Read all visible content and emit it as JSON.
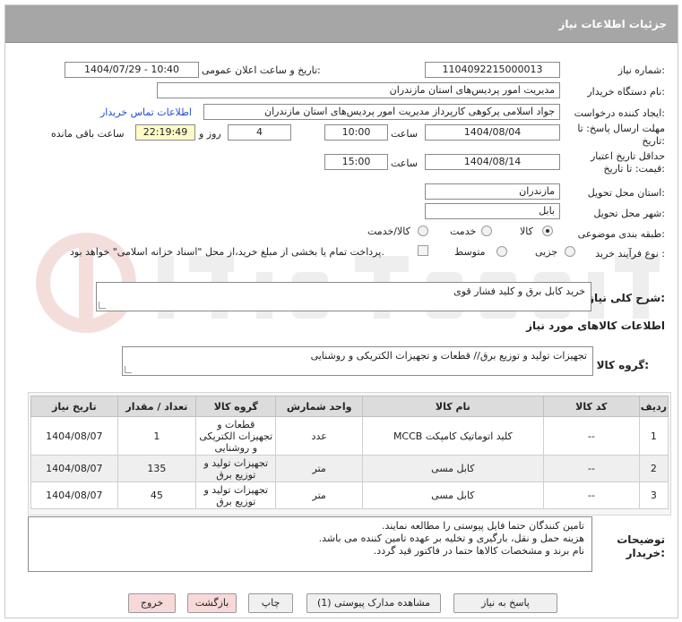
{
  "header": {
    "title": "جزئیات اطلاعات نیاز"
  },
  "form": {
    "need_number": {
      "label": "شماره نیاز:",
      "value": "1104092215000013"
    },
    "announce": {
      "label": "تاریخ و ساعت اعلان عمومی:",
      "value": "1404/07/29 - 10:40"
    },
    "buyer_org": {
      "label": "نام دستگاه خریدار:",
      "value": "مدیریت امور پردیس‌های استان مازندران"
    },
    "requester": {
      "label": "ایجاد کننده درخواست:",
      "value": "جواد اسلامی پرکوهی کارپرداز مدیریت امور پردیس‌های استان مازندران",
      "contact_link": "اطلاعات تماس خریدار"
    },
    "reply_deadline": {
      "label_line1": "مهلت ارسال پاسخ: تا",
      "label_line2": "تاریخ:",
      "date": "1404/08/04",
      "time_label": "ساعت",
      "time": "10:00",
      "days": "4",
      "days_label": "روز و",
      "remaining": "22:19:49",
      "remaining_label": "ساعت باقی مانده"
    },
    "price_validity": {
      "label_line1": "حداقل تاریخ اعتبار",
      "label_line2": "قیمت: تا تاریخ:",
      "date": "1404/08/14",
      "time_label": "ساعت",
      "time": "15:00"
    },
    "province": {
      "label": "استان محل تحویل:",
      "value": "مازندران"
    },
    "city": {
      "label": "شهر محل تحویل:",
      "value": "بابل"
    },
    "category": {
      "label": "طبقه بندی موضوعی:",
      "options": [
        "کالا",
        "خدمت",
        "کالا/خدمت"
      ],
      "selected": "کالا"
    },
    "purchase_type": {
      "label": "نوع فرآیند خرید :",
      "options": [
        "جزیی",
        "متوسط"
      ],
      "selected": "",
      "payment_note": "پرداخت تمام یا بخشی از مبلغ خرید،از محل \"اسناد خزانه اسلامی\" خواهد بود."
    }
  },
  "description": {
    "label": "شرح کلی نیاز:",
    "value": "خرید کابل برق و کلید فشار قوی"
  },
  "goods_section": {
    "title": "اطلاعات کالاهای مورد نیاز"
  },
  "goods_group": {
    "label": "گروه کالا:",
    "value": "تجهیزات تولید و توزیع برق// قطعات و تجهیزات الکتریکی و روشنایی"
  },
  "table": {
    "headers": [
      "ردیف",
      "کد کالا",
      "نام کالا",
      "واحد شمارش",
      "گروه کالا",
      "تعداد / مقدار",
      "تاریخ نیاز"
    ],
    "rows": [
      {
        "row": "1",
        "code": "--",
        "name": "کلید اتوماتیک کامپکت MCCB",
        "unit": "عدد",
        "group": "قطعات و تجهیزات الکتریکی و روشنایی",
        "qty": "1",
        "date": "1404/08/07"
      },
      {
        "row": "2",
        "code": "--",
        "name": "کابل مسی",
        "unit": "متر",
        "group": "تجهیزات تولید و توزیع برق",
        "qty": "135",
        "date": "1404/08/07"
      },
      {
        "row": "3",
        "code": "--",
        "name": "کابل مسی",
        "unit": "متر",
        "group": "تجهیزات تولید و توزیع برق",
        "qty": "45",
        "date": "1404/08/07"
      }
    ]
  },
  "notes": {
    "label_line1": "توضیحات",
    "label_line2": "خریدار:",
    "lines": [
      "تامین کنندگان حتما فایل پیوستی را مطالعه نمایند.",
      "هزینه حمل و نقل، بارگیری و تخلیه بر عهده تامین کننده می باشد.",
      "نام برند و مشخصات کالاها حتما در فاکتور قید گردد."
    ]
  },
  "buttons": {
    "reply": "پاسخ به نیاز",
    "docs": "مشاهده مدارک پیوستی (1)",
    "print": "چاپ",
    "back": "بازگشت",
    "exit": "خروج"
  },
  "colors": {
    "header_bg": "#a6a6a6",
    "link": "#1f4fd0",
    "remaining_bg": "#fffbc8",
    "exit_btn": "#f7d9d9"
  }
}
